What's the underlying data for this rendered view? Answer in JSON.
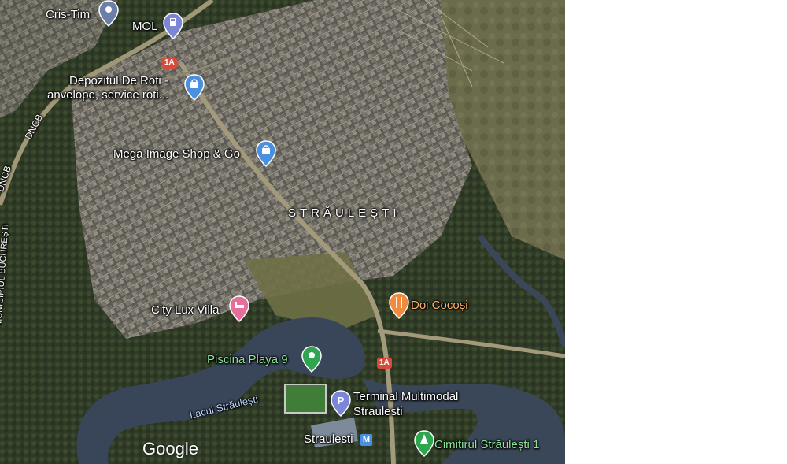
{
  "map": {
    "area_label": "STRĂULEȘTI",
    "water_label": "Lacul Străulești",
    "road_labels": {
      "dncb_upper": "DNCB",
      "dncb_lower": "DNCB",
      "municipiul": "MUNICIPIUL BUCUREȘTI"
    },
    "route_shields": [
      "1A",
      "1A"
    ],
    "pois": [
      {
        "name": "Cris-Tim",
        "icon": "location-pin-icon",
        "color": "#6b7fa8"
      },
      {
        "name": "MOL",
        "icon": "gas-station-icon",
        "color": "#7b86d6"
      },
      {
        "name_line1": "Depozitul De Roti -",
        "name_line2": "anvelope, service roti...",
        "icon": "shopping-bag-icon",
        "color": "#4a8fe0"
      },
      {
        "name": "Mega Image Shop & Go",
        "icon": "shopping-bag-icon",
        "color": "#4a8fe0"
      },
      {
        "name": "City Lux Villa",
        "icon": "hotel-bed-icon",
        "color": "#e76e9a"
      },
      {
        "name": "Doi Cocoși",
        "icon": "restaurant-icon",
        "color": "#f08a3c"
      },
      {
        "name": "Piscina Playa 9",
        "icon": "park-pin-icon",
        "color": "#2fa54f"
      },
      {
        "name_line1": "Terminal Multimodal",
        "name_line2": "Straulesti",
        "icon": "parking-icon",
        "color": "#7b86d6"
      },
      {
        "name": "Straulesti",
        "icon": "metro-icon",
        "color": "#4a8fe0",
        "badge": "M"
      },
      {
        "name": "Cimitirul Străulești 1",
        "icon": "cemetery-icon",
        "color": "#2fa54f"
      }
    ],
    "attribution": "Google"
  }
}
